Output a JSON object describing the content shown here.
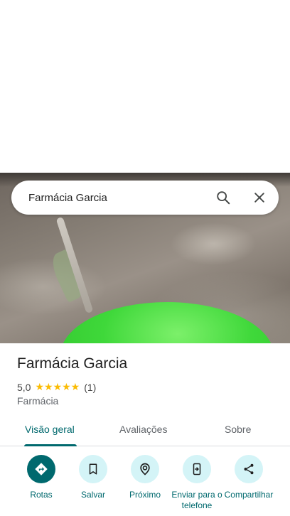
{
  "search": {
    "query": "Farmácia Garcia"
  },
  "place": {
    "title": "Farmácia Garcia",
    "rating": "5,0",
    "stars": "★★★★★",
    "review_count": "(1)",
    "category": "Farmácia"
  },
  "tabs": [
    {
      "label": "Visão geral",
      "active": true
    },
    {
      "label": "Avaliações",
      "active": false
    },
    {
      "label": "Sobre",
      "active": false
    }
  ],
  "actions": [
    {
      "label": "Rotas",
      "icon": "directions-icon"
    },
    {
      "label": "Salvar",
      "icon": "bookmark-icon"
    },
    {
      "label": "Próximo",
      "icon": "nearby-icon"
    },
    {
      "label": "Enviar para o telefone",
      "icon": "send-to-phone-icon"
    },
    {
      "label": "Compartilhar",
      "icon": "share-icon"
    }
  ],
  "colors": {
    "accent": "#00696e",
    "action_bg": "#d4f4f7",
    "star": "#fbbc04"
  }
}
